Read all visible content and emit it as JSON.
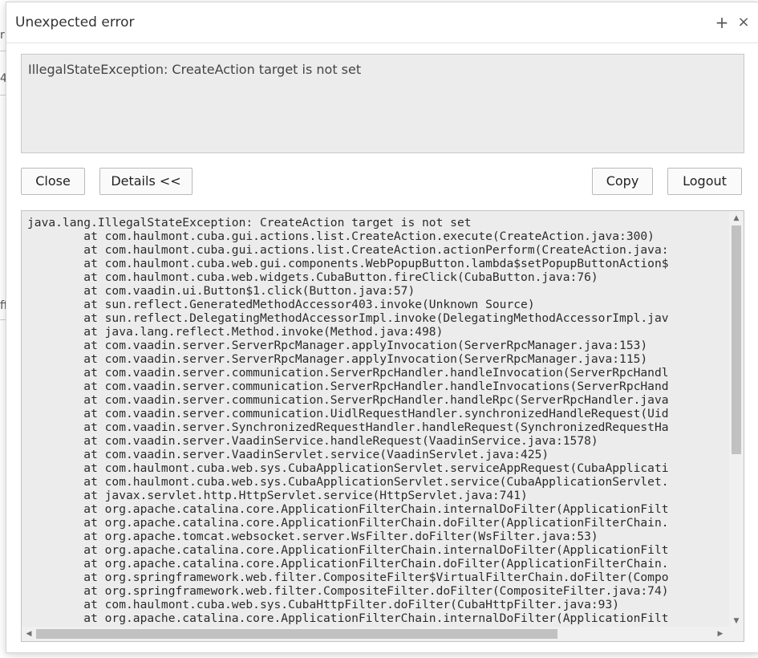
{
  "background": {
    "fragments": [
      "r",
      "4",
      "ff"
    ]
  },
  "dialog": {
    "title": "Unexpected error",
    "maximize_glyph": "+",
    "close_glyph": "×",
    "message": "IllegalStateException: CreateAction target is not set",
    "buttons": {
      "close": "Close",
      "details": "Details <<",
      "copy": "Copy",
      "logout": "Logout"
    },
    "stacktrace": [
      "java.lang.IllegalStateException: CreateAction target is not set",
      "\tat com.haulmont.cuba.gui.actions.list.CreateAction.execute(CreateAction.java:300)",
      "\tat com.haulmont.cuba.gui.actions.list.CreateAction.actionPerform(CreateAction.java:",
      "\tat com.haulmont.cuba.web.gui.components.WebPopupButton.lambda$setPopupButtonAction$",
      "\tat com.haulmont.cuba.web.widgets.CubaButton.fireClick(CubaButton.java:76)",
      "\tat com.vaadin.ui.Button$1.click(Button.java:57)",
      "\tat sun.reflect.GeneratedMethodAccessor403.invoke(Unknown Source)",
      "\tat sun.reflect.DelegatingMethodAccessorImpl.invoke(DelegatingMethodAccessorImpl.jav",
      "\tat java.lang.reflect.Method.invoke(Method.java:498)",
      "\tat com.vaadin.server.ServerRpcManager.applyInvocation(ServerRpcManager.java:153)",
      "\tat com.vaadin.server.ServerRpcManager.applyInvocation(ServerRpcManager.java:115)",
      "\tat com.vaadin.server.communication.ServerRpcHandler.handleInvocation(ServerRpcHandl",
      "\tat com.vaadin.server.communication.ServerRpcHandler.handleInvocations(ServerRpcHand",
      "\tat com.vaadin.server.communication.ServerRpcHandler.handleRpc(ServerRpcHandler.java",
      "\tat com.vaadin.server.communication.UidlRequestHandler.synchronizedHandleRequest(Uid",
      "\tat com.vaadin.server.SynchronizedRequestHandler.handleRequest(SynchronizedRequestHa",
      "\tat com.vaadin.server.VaadinService.handleRequest(VaadinService.java:1578)",
      "\tat com.vaadin.server.VaadinServlet.service(VaadinServlet.java:425)",
      "\tat com.haulmont.cuba.web.sys.CubaApplicationServlet.serviceAppRequest(CubaApplicati",
      "\tat com.haulmont.cuba.web.sys.CubaApplicationServlet.service(CubaApplicationServlet.",
      "\tat javax.servlet.http.HttpServlet.service(HttpServlet.java:741)",
      "\tat org.apache.catalina.core.ApplicationFilterChain.internalDoFilter(ApplicationFilt",
      "\tat org.apache.catalina.core.ApplicationFilterChain.doFilter(ApplicationFilterChain.",
      "\tat org.apache.tomcat.websocket.server.WsFilter.doFilter(WsFilter.java:53)",
      "\tat org.apache.catalina.core.ApplicationFilterChain.internalDoFilter(ApplicationFilt",
      "\tat org.apache.catalina.core.ApplicationFilterChain.doFilter(ApplicationFilterChain.",
      "\tat org.springframework.web.filter.CompositeFilter$VirtualFilterChain.doFilter(Compo",
      "\tat org.springframework.web.filter.CompositeFilter.doFilter(CompositeFilter.java:74)",
      "\tat com.haulmont.cuba.web.sys.CubaHttpFilter.doFilter(CubaHttpFilter.java:93)",
      "\tat org.apache.catalina.core.ApplicationFilterChain.internalDoFilter(ApplicationFilt"
    ],
    "icons": {
      "scroll_up": "arrow-up-icon",
      "scroll_down": "arrow-down-icon",
      "scroll_left": "arrow-left-icon",
      "scroll_right": "arrow-right-icon"
    }
  }
}
